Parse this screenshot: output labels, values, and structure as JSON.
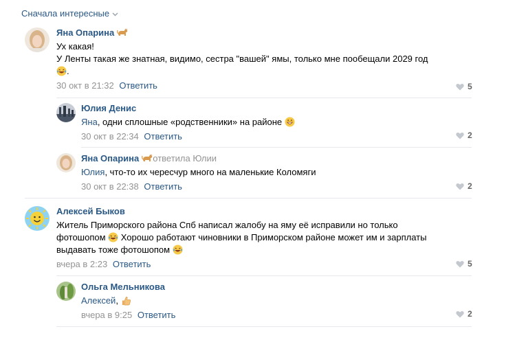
{
  "sort": {
    "label": "Сначала интересные"
  },
  "comments": [
    {
      "author": "Яна Опарина",
      "line1": "Ух какая!",
      "line2": "У Ленты такая же знатная, видимо, сестра \"вашей\" ямы, только мне пообещали 2029 год",
      "line3": ".",
      "date": "30 окт в 21:32",
      "reply": "Ответить",
      "likes": "5"
    },
    {
      "author": "Юлия Денис",
      "mention": "Яна",
      "text": ", одни сплошные «родственники» на районе",
      "date": "30 окт в 22:34",
      "reply": "Ответить",
      "likes": "2"
    },
    {
      "author": "Яна Опарина",
      "reply_to": "ответила Юлии",
      "mention": "Юлия",
      "text": ", что-то их чересчур много на маленькие Коломяги",
      "date": "30 окт в 22:38",
      "reply": "Ответить",
      "likes": "2"
    },
    {
      "author": "Алексей Быков",
      "line1": "Житель Приморского района Спб написал жалобу на яму её исправили но только",
      "line2a": "фотошопом",
      "line2b": " Хорошо работают чиновники в Приморском районе может им и зарплаты",
      "line3": "выдавать тоже фотошопом",
      "date": "вчера в 2:23",
      "reply": "Ответить",
      "likes": "5"
    },
    {
      "author": "Ольга Мельникова",
      "mention": "Алексей",
      "text": ",",
      "date": "вчера в 9:25",
      "reply": "Ответить",
      "likes": "2"
    }
  ],
  "colors": {
    "link": "#2a5885",
    "meta": "#939393",
    "divider": "#e7e8ec"
  }
}
